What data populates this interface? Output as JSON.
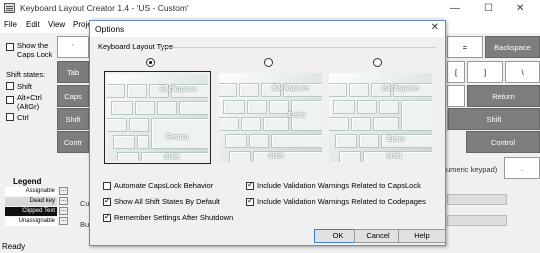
{
  "app": {
    "title": "Keyboard Layout Creator 1.4 - 'US - Custom'",
    "menu": [
      "File",
      "Edit",
      "View",
      "Proje"
    ]
  },
  "side": {
    "show_caps_lock": "Show the Caps Lock",
    "shift_states_label": "Shift states:",
    "shift": "Shift",
    "alt_ctrl": "Alt+Ctrl (AltGr)",
    "ctrl": "Ctrl"
  },
  "legend": {
    "title": "Legend",
    "items": [
      "Assignable",
      "Dead key",
      "Clipped Text",
      "Unassignable"
    ]
  },
  "status": "Ready",
  "behind": {
    "right_keys": [
      "=",
      "Backspace",
      "[",
      "]",
      "\\",
      "Return",
      "Shift",
      "Control",
      "."
    ],
    "left_keys": [
      "`",
      "Tab",
      "Caps",
      "Shift",
      "Contr"
    ],
    "numeric_keypad": "umeric keypad)",
    "cur": "Cur",
    "buil": "Buil",
    "win_controls": [
      "—",
      "☐",
      "✕"
    ]
  },
  "dialog": {
    "title": "Options",
    "close": "✕",
    "group_title": "Keyboard Layout Type",
    "layouts": [
      {
        "selected": true,
        "labels": [
          "Backspace",
          "Return",
          "Shift"
        ]
      },
      {
        "selected": false,
        "labels": [
          "Backspace",
          "Enter",
          "Shift"
        ]
      },
      {
        "selected": false,
        "labels": [
          "Backspace",
          "Enter",
          "Shift"
        ]
      }
    ],
    "options": [
      {
        "label": "Automate CapsLock Behavior",
        "checked": false
      },
      {
        "label": "Show All Shift States By Default",
        "checked": true
      },
      {
        "label": "Remember Settings After Shutdown",
        "checked": true
      },
      {
        "label": "Include Validation Warnings Related to CapsLock",
        "checked": true
      },
      {
        "label": "Include Validation Warnings Related to Codepages",
        "checked": true
      }
    ],
    "buttons": {
      "ok": "OK",
      "cancel": "Cancel",
      "help": "Help"
    }
  }
}
